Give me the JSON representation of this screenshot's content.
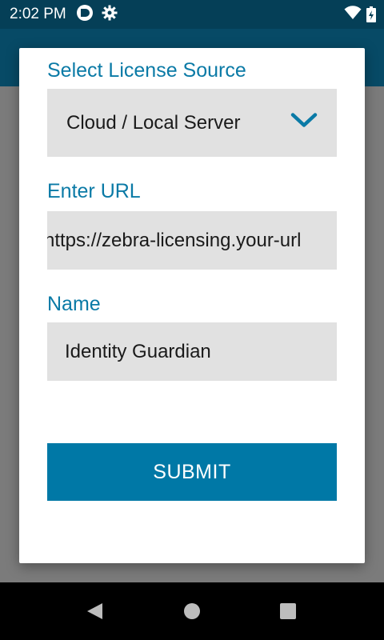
{
  "status_bar": {
    "time": "2:02 PM",
    "left_icons": [
      "notification-app-icon",
      "gear-icon"
    ],
    "right_icons": [
      "wifi-icon",
      "battery-charging-icon"
    ]
  },
  "dialog": {
    "license_source": {
      "label": "Select License Source",
      "selected": "Cloud / Local Server",
      "icon": "chevron-down-icon"
    },
    "url": {
      "label": "Enter URL",
      "value": "https://zebra-licensing.your-url"
    },
    "name": {
      "label": "Name",
      "value": "Identity Guardian"
    },
    "submit_label": "SUBMIT"
  },
  "colors": {
    "status_bar": "#053f57",
    "app_bar": "#074a66",
    "accent_label": "#0a7aa6",
    "button": "#0078a6",
    "field_bg": "#e1e1e1"
  },
  "nav_bar": {
    "buttons": [
      "back-icon",
      "home-icon",
      "recents-icon"
    ]
  }
}
